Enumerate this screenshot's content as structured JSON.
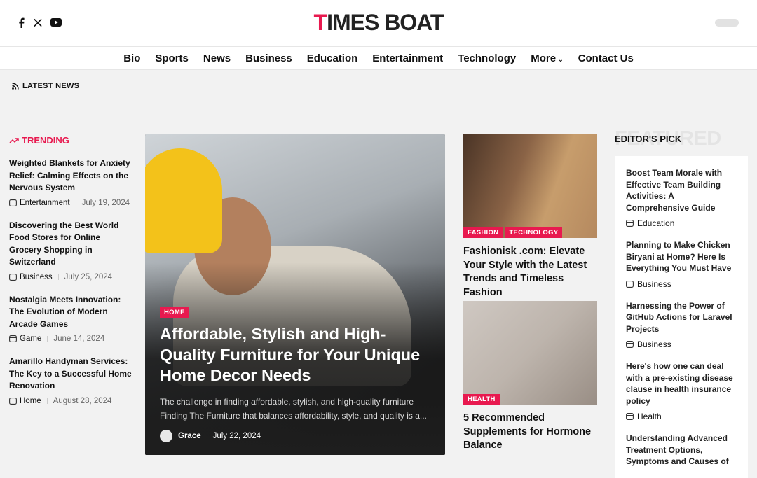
{
  "header": {
    "logo_accent": "T",
    "logo_rest": "IMES BOAT",
    "social": [
      "facebook-icon",
      "x-icon",
      "youtube-icon"
    ]
  },
  "nav": {
    "items": [
      "Bio",
      "Sports",
      "News",
      "Business",
      "Education",
      "Entertainment",
      "Technology",
      "More",
      "Contact Us"
    ]
  },
  "latest_news_label": "LATEST NEWS",
  "trending": {
    "heading": "TRENDING",
    "items": [
      {
        "title": "Weighted Blankets for Anxiety Relief: Calming Effects on the Nervous System",
        "category": "Entertainment",
        "date": "July 19, 2024"
      },
      {
        "title": "Discovering the Best World Food Stores for Online Grocery Shopping in Switzerland",
        "category": "Business",
        "date": "July 25, 2024"
      },
      {
        "title": "Nostalgia Meets Innovation: The Evolution of Modern Arcade Games",
        "category": "Game",
        "date": "June 14, 2024"
      },
      {
        "title": "Amarillo Handyman Services: The Key to a Successful Home Renovation",
        "category": "Home",
        "date": "August 28, 2024"
      }
    ]
  },
  "featured": {
    "badge": "HOME",
    "title": "Affordable, Stylish and High-Quality Furniture for Your Unique Home Decor Needs",
    "excerpt": "The challenge in finding affordable, stylish, and high-quality furniture Finding The Furniture that balances affordability, style, and quality is a...",
    "author": "Grace",
    "date": "July 22, 2024"
  },
  "cards": [
    {
      "badges": [
        "FASHION",
        "TECHNOLOGY"
      ],
      "title": "Fashionisk .com: Elevate Your Style with the Latest Trends and Timeless Fashion"
    },
    {
      "badges": [
        "HEALTH"
      ],
      "title": "5 Recommended Supplements for Hormone Balance"
    }
  ],
  "editors": {
    "watermark": "FEATURED",
    "label": "EDITOR'S PICK",
    "items": [
      {
        "title": "Boost Team Morale with Effective Team Building Activities: A Comprehensive Guide",
        "category": "Education"
      },
      {
        "title": "Planning to Make Chicken Biryani at Home? Here Is Everything You Must Have",
        "category": "Business"
      },
      {
        "title": "Harnessing the Power of GitHub Actions for Laravel Projects",
        "category": "Business"
      },
      {
        "title": "Here's how one can deal with a pre-existing disease clause in health insurance policy",
        "category": "Health"
      },
      {
        "title": "Understanding Advanced Treatment Options, Symptoms and Causes of",
        "category": ""
      }
    ]
  },
  "colors": {
    "accent": "#e8194f"
  }
}
